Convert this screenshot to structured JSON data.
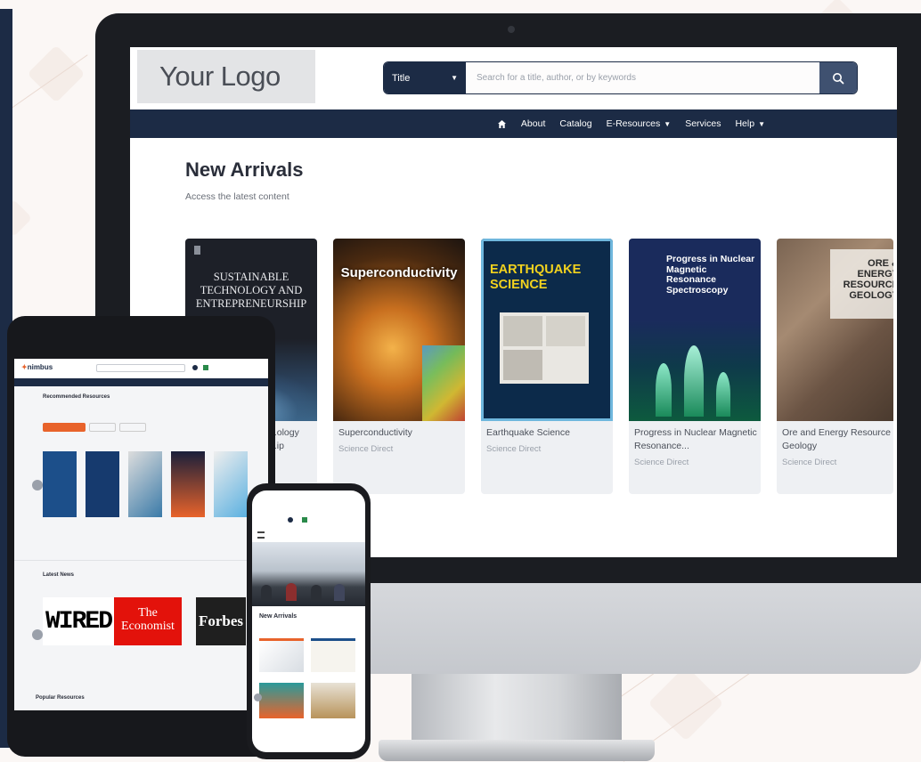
{
  "desktop": {
    "logo": "Your Logo",
    "search": {
      "field": "Title",
      "placeholder": "Search for a title, author, or by keywords"
    },
    "nav": [
      "About",
      "Catalog",
      "E-Resources",
      "Services",
      "Help"
    ],
    "section_title": "New Arrivals",
    "section_subtitle": "Access the latest content",
    "books": [
      {
        "title": "Sustainable Technology and Entrepreneurship",
        "visible_title": "...ology ...ip",
        "source": "",
        "cover_text": "SUSTAINABLE TECHNOLOGY AND ENTREPRENEURSHIP"
      },
      {
        "title": "Superconductivity",
        "source": "Science Direct",
        "cover_text": "Superconductivity"
      },
      {
        "title": "Earthquake Science",
        "source": "Science Direct",
        "cover_text": "EARTHQUAKE SCIENCE"
      },
      {
        "title": "Progress in Nuclear Magnetic Resonance...",
        "source": "Science Direct",
        "cover_text": "Progress in Nuclear Magnetic Resonance Spectroscopy"
      },
      {
        "title": "Ore and Energy Resource Geology",
        "source": "Science Direct",
        "cover_text": "ORE & ENERGY RESOURCE GEOLOGY"
      }
    ]
  },
  "tablet": {
    "logo": "nimbus",
    "section_title": "Recommended Resources",
    "news_title": "Latest News",
    "news_logos": [
      "WIRED",
      "The Economist",
      "Forbes"
    ],
    "popular_title": "Popular Resources"
  },
  "phone": {
    "section_title": "New Arrivals"
  },
  "colors": {
    "navy": "#1c2b45",
    "accent_orange": "#e8632b",
    "economist_red": "#e3120b"
  }
}
